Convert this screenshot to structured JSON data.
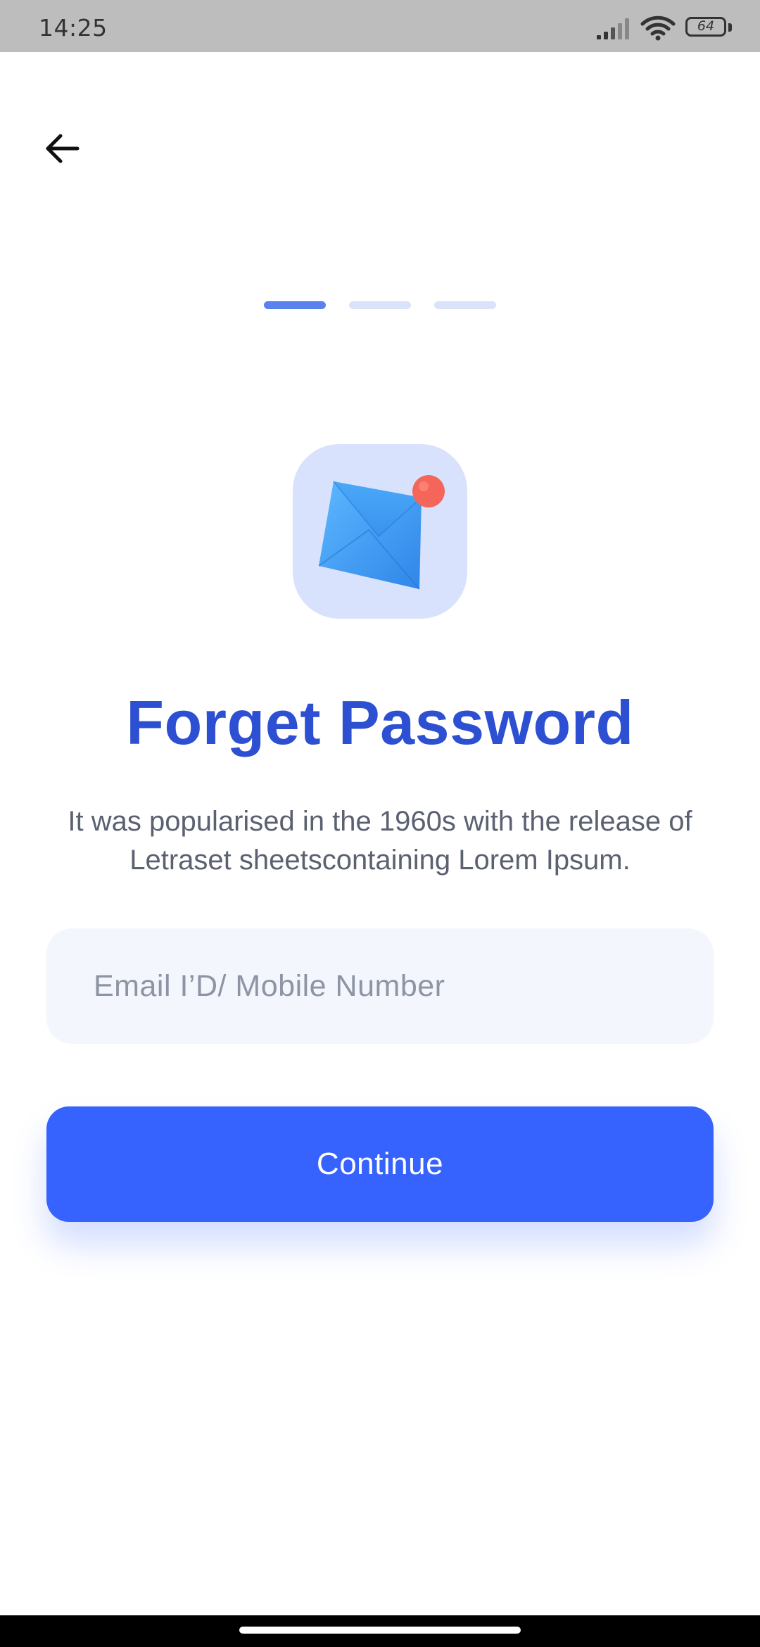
{
  "status_bar": {
    "time": "14:25",
    "battery": "64",
    "icons": [
      "signal-icon",
      "wifi-icon",
      "battery-icon"
    ]
  },
  "header": {
    "back_icon": "arrow-left-icon"
  },
  "steps": {
    "total": 3,
    "current": 1
  },
  "illustration": {
    "icon": "envelope-notification-icon"
  },
  "page": {
    "title": "Forget Password",
    "description": "It was popularised in the 1960s with the release of Letraset sheetscontaining Lorem Ipsum."
  },
  "form": {
    "email_placeholder": "Email I’D/ Mobile Number",
    "email_value": "",
    "continue_label": "Continue"
  },
  "colors": {
    "accent": "#3662fd",
    "title": "#2d4fd1",
    "step_active": "#5a82ee",
    "step_inactive": "#dbe3fb",
    "input_bg": "#f3f6fc",
    "icon_tile_bg": "#d9e2fd",
    "notification_dot": "#f4665a"
  }
}
